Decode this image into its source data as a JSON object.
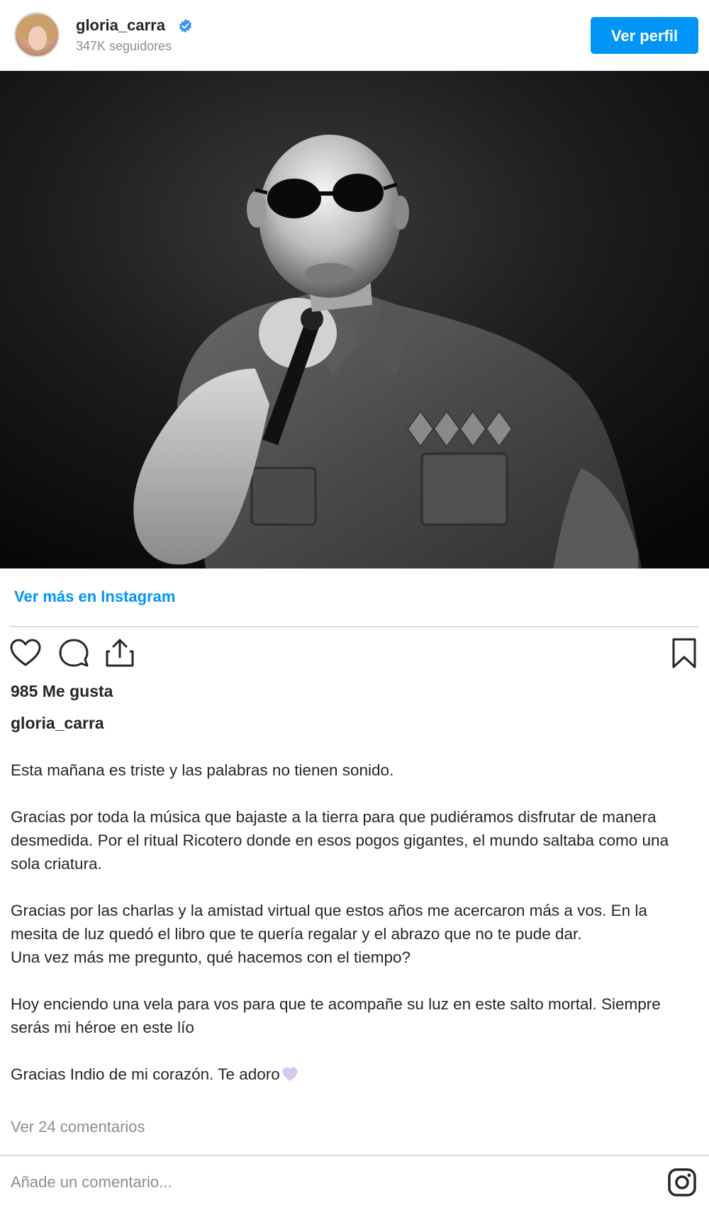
{
  "header": {
    "username": "gloria_carra",
    "followers": "347K seguidores",
    "view_profile_label": "Ver perfil"
  },
  "post": {
    "view_more_label": "Ver más en Instagram",
    "likes": "985 Me gusta",
    "caption_user": "gloria_carra",
    "caption_paragraphs": [
      "Esta mañana es triste y las palabras no tienen sonido.",
      "Gracias por toda la música que bajaste a la tierra para que pudiéramos disfrutar de manera desmedida. Por el ritual Ricotero donde en esos pogos gigantes, el mundo saltaba como una sola criatura.",
      "Gracias por las charlas y la amistad virtual que estos años me acercaron más a vos. En la mesita de luz quedó el libro que te quería regalar y el abrazo que no te pude dar.\nUna vez más me pregunto, qué hacemos con el tiempo?",
      "Hoy enciendo una vela para vos para que te acompañe su luz en este salto mortal. Siempre serás mi héroe en este lío",
      "Gracias Indio de mi corazón. Te adoro"
    ],
    "view_comments_label": "Ver 24 comentarios",
    "comment_placeholder": "Añade un comentario..."
  },
  "icons": {
    "verified": "verified-badge-icon",
    "like": "heart-icon",
    "comment": "comment-icon",
    "share": "share-icon",
    "save": "bookmark-icon",
    "emoji": "purple-heart-icon",
    "instagram": "instagram-logo-icon"
  },
  "colors": {
    "accent": "#0095f6",
    "text": "#262626",
    "muted": "#8e8e8e",
    "divider": "#dbdbdb"
  }
}
